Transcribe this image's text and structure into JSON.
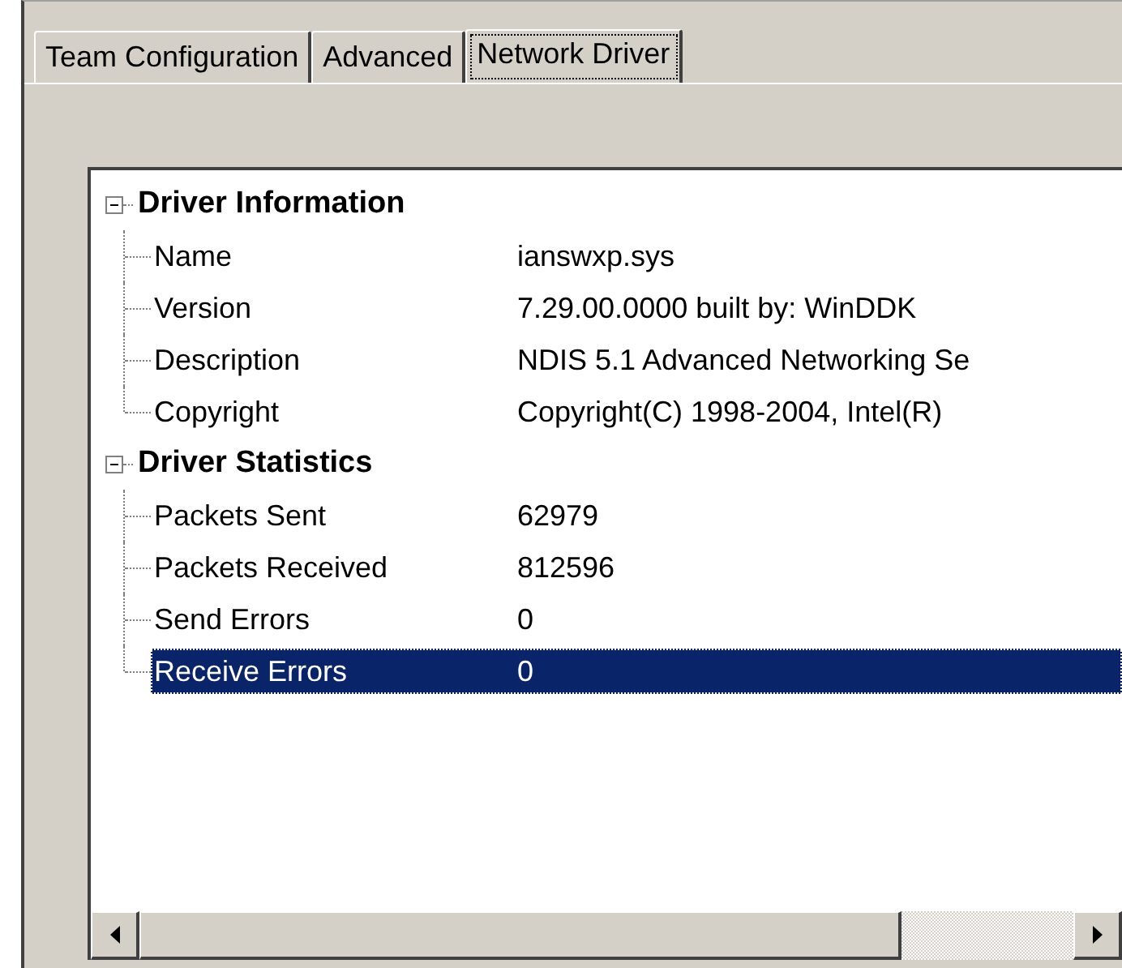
{
  "tabs": [
    {
      "label": "Team Configuration",
      "selected": false
    },
    {
      "label": "Advanced",
      "selected": false
    },
    {
      "label": "Network Driver",
      "selected": true
    }
  ],
  "tree": [
    {
      "label": "Driver Information",
      "expanded": true,
      "children": [
        {
          "label": "Name",
          "value": "ianswxp.sys",
          "selected": false
        },
        {
          "label": "Version",
          "value": "7.29.00.0000 built by: WinDDK",
          "selected": false
        },
        {
          "label": "Description",
          "value": "NDIS 5.1 Advanced Networking Se",
          "selected": false
        },
        {
          "label": "Copyright",
          "value": "Copyright(C) 1998-2004, Intel(R)",
          "selected": false
        }
      ]
    },
    {
      "label": "Driver Statistics",
      "expanded": true,
      "children": [
        {
          "label": "Packets Sent",
          "value": "62979",
          "selected": false
        },
        {
          "label": "Packets Received",
          "value": "812596",
          "selected": false
        },
        {
          "label": "Send Errors",
          "value": "0",
          "selected": false
        },
        {
          "label": "Receive Errors",
          "value": "0",
          "selected": true
        }
      ]
    }
  ]
}
